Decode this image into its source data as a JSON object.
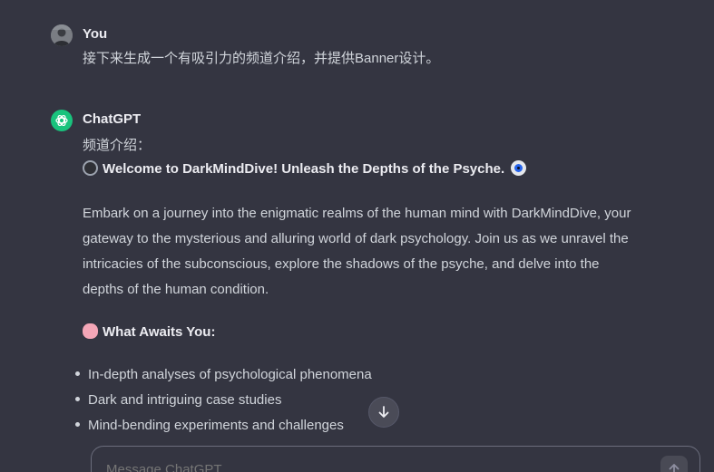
{
  "user_message": {
    "sender": "You",
    "text": "接下来生成一个有吸引力的频道介绍，并提供Banner设计。"
  },
  "assistant_message": {
    "sender": "ChatGPT",
    "intro_label": "频道介绍：",
    "headline_emoji": "film-reel-icon",
    "headline": "Welcome to DarkMindDive! Unleash the Depths of the Psyche.",
    "headline_end_emoji": "eye-icon",
    "paragraph_lines": [
      "Embark on a journey into the enigmatic realms of the human mind with DarkMindDive, your",
      "gateway to the mysterious and alluring world of dark psychology. Join us as we unravel the",
      "intricacies of the subconscious, explore the shadows of the psyche, and delve into the",
      "depths of the human condition."
    ],
    "section_emoji": "brain-icon",
    "section_title": "What Awaits You:",
    "bullets": [
      "In-depth analyses of psychological phenomena",
      "Dark and intriguing case studies",
      "Mind-bending experiments and challenges"
    ]
  },
  "composer": {
    "placeholder": "Message ChatGPT"
  },
  "colors": {
    "background": "#343541",
    "gpt_avatar": "#19c37d",
    "text": "#d1d5db"
  }
}
